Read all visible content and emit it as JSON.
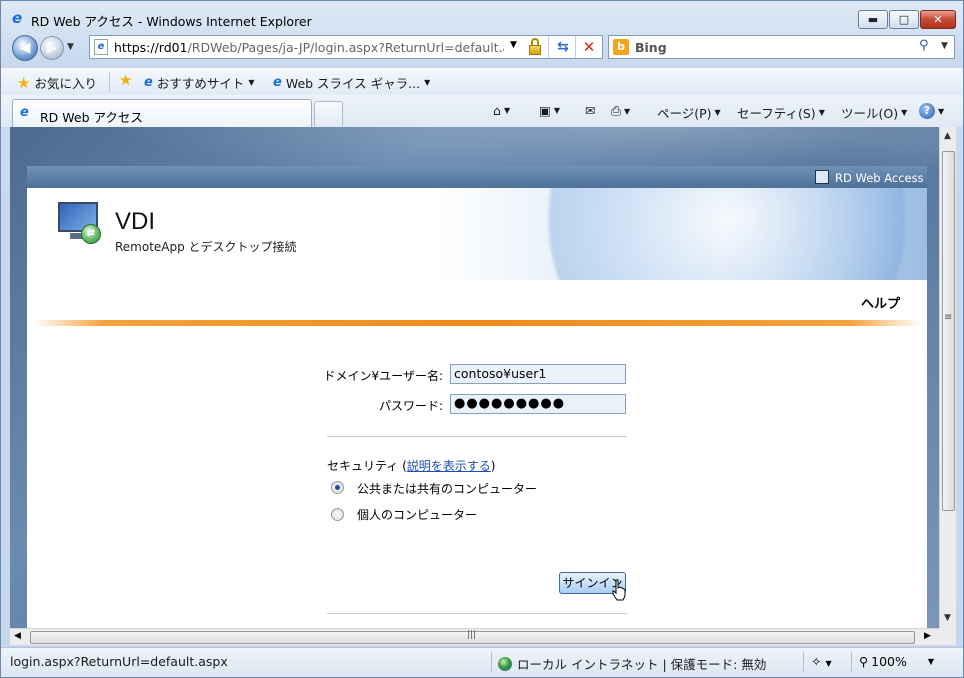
{
  "window": {
    "title": "RD Web アクセス - Windows Internet Explorer",
    "minimize": "▬",
    "maximize": "□",
    "close": "✕"
  },
  "address_bar": {
    "url_host": "https://rd01",
    "url_path": "/RDWeb/Pages/ja-JP/login.aspx?ReturnUrl=default.asp",
    "dropdown": "▼"
  },
  "search": {
    "provider": "Bing"
  },
  "favorites_bar": {
    "favorites": "お気に入り",
    "suggested_sites": "おすすめサイト",
    "web_slice": "Web スライス ギャラ..."
  },
  "tabs": [
    {
      "label": "RD Web アクセス"
    }
  ],
  "command_bar": {
    "page": "ページ(P)",
    "safety": "セーフティ(S)",
    "tools": "ツール(O)"
  },
  "page": {
    "header_right": "RD Web Access",
    "app_title": "VDI",
    "app_subtitle": "RemoteApp とデスクトップ接続",
    "help": "ヘルプ",
    "form": {
      "domain_user_label": "ドメイン¥ユーザー名:",
      "domain_user_value": "contoso¥user1",
      "password_label": "パスワード:",
      "password_value": "●●●●●●●●●",
      "security_label": "セキュリティ (",
      "security_link": "説明を表示する",
      "security_close": ")",
      "option_public": "公共または共有のコンピューター",
      "option_private": "個人のコンピューター",
      "selected_option": "public",
      "signin": "サインイン"
    }
  },
  "status_bar": {
    "url": "login.aspx?ReturnUrl=default.aspx",
    "zone": "ローカル イントラネット | 保護モード: 無効",
    "zoom": "100%"
  },
  "colors": {
    "accent_orange": "#f08a1a",
    "header_blue": "#4e7198",
    "link_blue": "#1b4fb3"
  }
}
